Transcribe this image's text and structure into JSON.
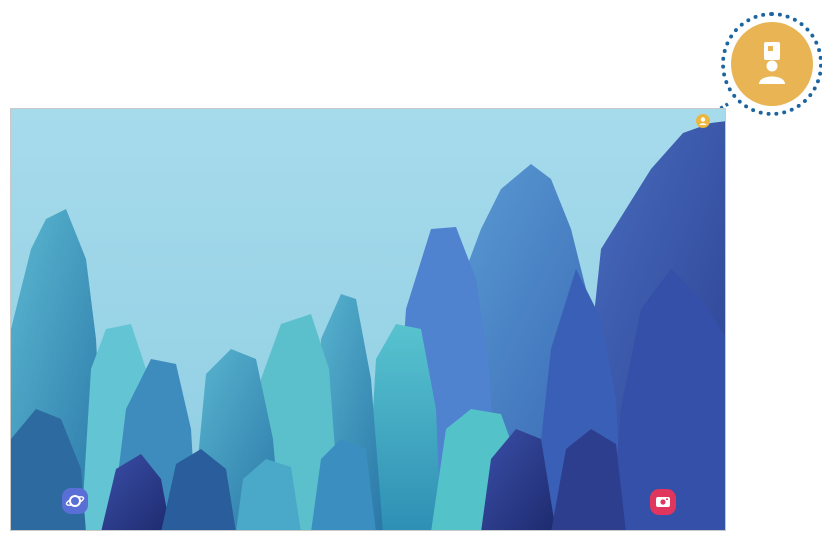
{
  "colors": {
    "sky": "#9fd6e9",
    "profile_accent": "#ecb73e",
    "callout_fill": "#e8b454",
    "callout_border": "#1d65a0",
    "browser_shortcut": "#5a6fd6",
    "camera_shortcut": "#e0365d"
  },
  "status_bar": {
    "left_text": "",
    "right_text": ""
  },
  "lock_screen": {
    "clock": "",
    "date": "",
    "unlock_hint": ""
  },
  "icons": {
    "profile": "user-profile-icon",
    "browser": "internet-browser-icon",
    "camera": "camera-icon",
    "callout": "profile-callout-icon"
  }
}
